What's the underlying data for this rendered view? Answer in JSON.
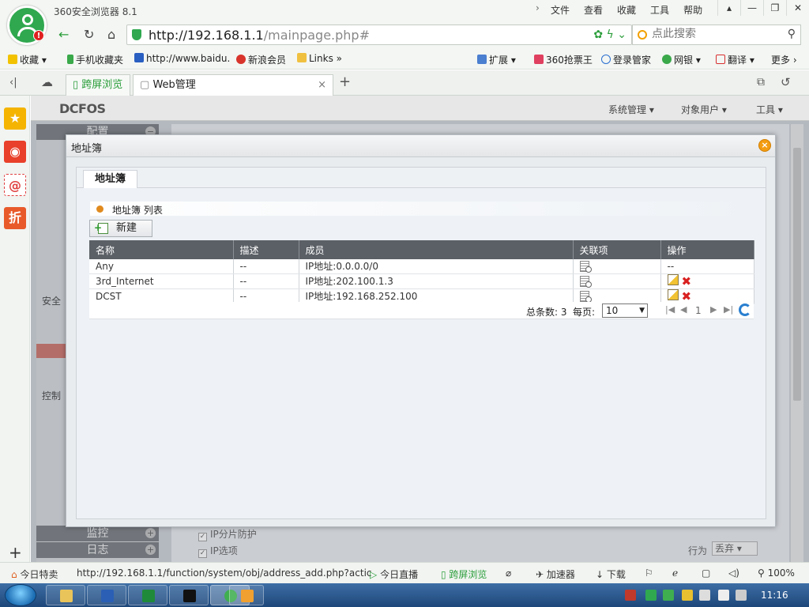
{
  "browser": {
    "title": "360安全浏览器 8.1",
    "menu": [
      "文件",
      "查看",
      "收藏",
      "工具",
      "帮助"
    ],
    "url_host": "http://192.168.1.1",
    "url_path": "/mainpage.php#",
    "search_placeholder": "点此搜索",
    "bookmarks": [
      "收藏",
      "手机收藏夹",
      "http://www.baidu.",
      "新浪会员",
      "Links",
      "扩展",
      "360抢票王",
      "登录管家",
      "网银",
      "翻译",
      "更多"
    ],
    "tabs": [
      {
        "label": "跨屏浏览"
      },
      {
        "label": "Web管理"
      }
    ],
    "status": {
      "left": "今日特卖",
      "link": "http://192.168.1.1/function/system/obj/address_add.php?actic",
      "live": "今日直播",
      "cross": "跨屏浏览",
      "accel": "加速器",
      "download": "下载",
      "zoom": "100%"
    }
  },
  "app": {
    "brand": "DCFOS",
    "header_menu": [
      "系统管理",
      "对象用户",
      "工具"
    ],
    "sidebar": {
      "config": "配置",
      "security": "安全",
      "control": "控制",
      "monitor": "监控",
      "log": "日志"
    },
    "bg_checks": [
      "IP分片防护",
      "IP选项"
    ],
    "bg_action_label": "行为",
    "bg_action_value": "丢弃"
  },
  "dialog": {
    "title": "地址簿",
    "tab": "地址簿",
    "section_title": "地址簿 列表",
    "new_button": "新建",
    "columns": [
      "名称",
      "描述",
      "成员",
      "关联项",
      "操作"
    ],
    "rows": [
      {
        "name": "Any",
        "desc": "--",
        "member": "IP地址:0.0.0.0/0",
        "ops": "--"
      },
      {
        "name": "3rd_Internet",
        "desc": "--",
        "member": "IP地址:202.100.1.3",
        "ops": ""
      },
      {
        "name": "DCST",
        "desc": "--",
        "member": "IP地址:192.168.252.100",
        "ops": ""
      }
    ],
    "pager": {
      "total": "总条数: 3",
      "per_page_label": "每页:",
      "per_page": "10",
      "page": "1"
    }
  },
  "taskbar": {
    "clock": "11:16"
  }
}
